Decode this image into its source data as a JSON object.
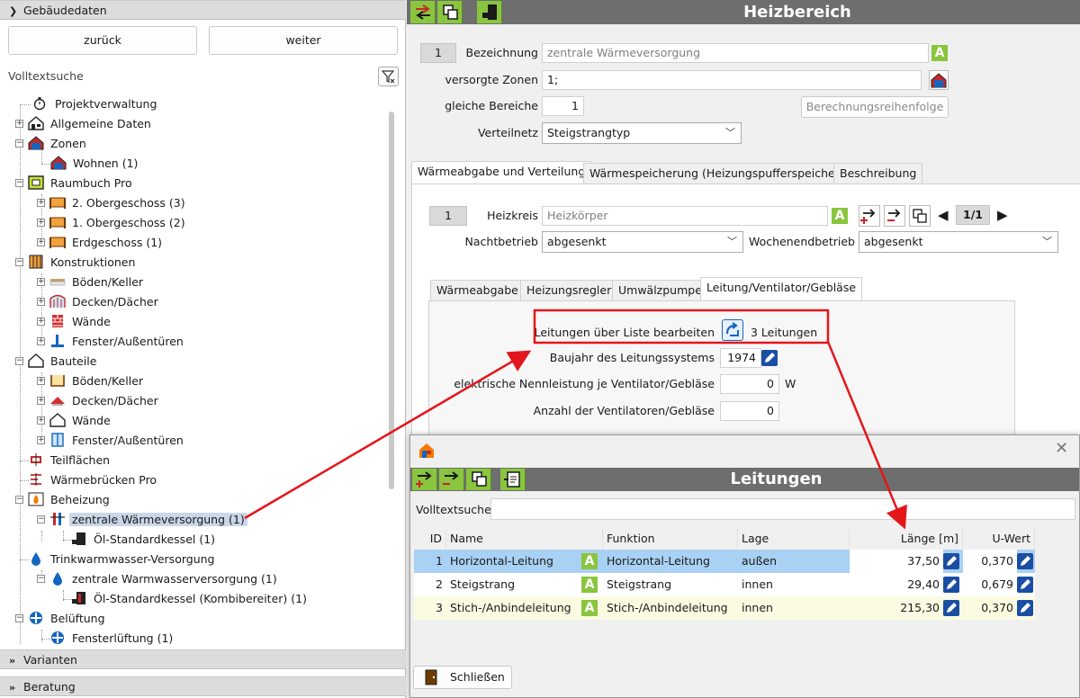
{
  "left": {
    "header": "Gebäudedaten",
    "back_button": "zurück",
    "next_button": "weiter",
    "search_label": "Volltextsuche",
    "tree": [
      {
        "label": "Projektverwaltung"
      },
      {
        "label": "Allgemeine Daten"
      },
      {
        "label": "Zonen"
      },
      {
        "label": "Wohnen (1)"
      },
      {
        "label": "Raumbuch Pro"
      },
      {
        "label": "2. Obergeschoss (3)"
      },
      {
        "label": "1. Obergeschoss (2)"
      },
      {
        "label": "Erdgeschoss (1)"
      },
      {
        "label": "Konstruktionen"
      },
      {
        "label": "Böden/Keller"
      },
      {
        "label": "Decken/Dächer"
      },
      {
        "label": "Wände"
      },
      {
        "label": "Fenster/Außentüren"
      },
      {
        "label": "Bauteile"
      },
      {
        "label": "Böden/Keller"
      },
      {
        "label": "Decken/Dächer"
      },
      {
        "label": "Wände"
      },
      {
        "label": "Fenster/Außentüren"
      },
      {
        "label": "Teilflächen"
      },
      {
        "label": "Wärmebrücken Pro"
      },
      {
        "label": "Beheizung"
      },
      {
        "label": "zentrale Wärmeversorgung (1)"
      },
      {
        "label": "Öl-Standardkessel (1)"
      },
      {
        "label": "Trinkwarmwasser-Versorgung"
      },
      {
        "label": "zentrale Warmwasserversorgung (1)"
      },
      {
        "label": "Öl-Standardkessel (Kombibereiter) (1)"
      },
      {
        "label": "Belüftung"
      },
      {
        "label": "Fensterlüftung (1)"
      }
    ],
    "section_varianten": "Varianten",
    "section_beratung": "Beratung"
  },
  "right": {
    "title": "Heizbereich",
    "index": "1",
    "bezeichnung_label": "Bezeichnung",
    "bezeichnung_value": "zentrale Wärmeversorgung",
    "zonen_label": "versorgte Zonen",
    "zonen_value": "1;",
    "gleiche_label": "gleiche Bereiche",
    "gleiche_value": "1",
    "berechnung_button": "Berechnungsreihenfolge",
    "verteilnetz_label": "Verteilnetz",
    "verteilnetz_value": "Steigstrangtyp",
    "tabs": [
      "Wärmeabgabe und Verteilung",
      "Wärmespeicherung (Heizungspufferspeicher)",
      "Beschreibung"
    ],
    "heizkreis_index": "1",
    "heizkreis_label": "Heizkreis",
    "heizkreis_value": "Heizkörper",
    "pager": "1/1",
    "nacht_label": "Nachtbetrieb",
    "nacht_value": "abgesenkt",
    "wochenende_label": "Wochenendbetrieb",
    "wochenende_value": "abgesenkt",
    "subtabs": [
      "Wärmeabgabe",
      "Heizungsregler",
      "Umwälzpumpe",
      "Leitung/Ventilator/Gebläse"
    ],
    "leitungen_label": "Leitungen über Liste bearbeiten",
    "leitungen_count": "3 Leitungen",
    "baujahr_label": "Baujahr des Leitungssystems",
    "baujahr_value": "1974",
    "nennleistung_label": "elektrische Nennleistung je Ventilator/Gebläse",
    "nennleistung_value": "0",
    "nennleistung_unit": "W",
    "anzahl_label": "Anzahl der Ventilatoren/Gebläse",
    "anzahl_value": "0"
  },
  "dialog": {
    "title": "Leitungen",
    "search_label": "Volltextsuche",
    "columns": [
      "ID",
      "Name",
      "Funktion",
      "Lage",
      "Länge [m]",
      "U-Wert"
    ],
    "rows": [
      {
        "id": "1",
        "name": "Horizontal-Leitung",
        "funktion": "Horizontal-Leitung",
        "lage": "außen",
        "laenge": "37,50",
        "uwert": "0,370"
      },
      {
        "id": "2",
        "name": "Steigstrang",
        "funktion": "Steigstrang",
        "lage": "innen",
        "laenge": "29,40",
        "uwert": "0,679"
      },
      {
        "id": "3",
        "name": "Stich-/Anbindeleitung",
        "funktion": "Stich-/Anbindeleitung",
        "lage": "innen",
        "laenge": "215,30",
        "uwert": "0,370"
      }
    ],
    "close_button": "Schließen"
  },
  "colors": {
    "accent_green": "#8ac53f",
    "titlebar_gray": "#6e6e6e",
    "selection_blue": "#a9d1f3",
    "annotation_red": "#e3161b"
  }
}
